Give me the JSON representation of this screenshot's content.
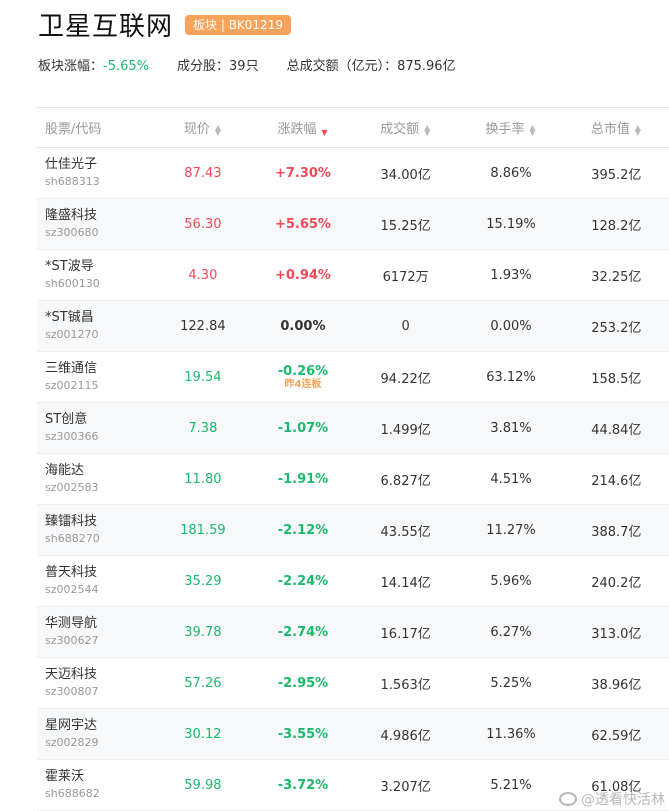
{
  "header": {
    "title": "卫星互联网",
    "tag": "板块 | BK01219"
  },
  "summary": {
    "change_label": "板块涨幅：",
    "change_value": "-5.65%",
    "count_label": "成分股：",
    "count_value": "39只",
    "turnover_label": "总成交额（亿元）：",
    "turnover_value": "875.96亿"
  },
  "table": {
    "headers": [
      "股票/代码",
      "现价",
      "涨跌幅",
      "成交额",
      "换手率",
      "总市值"
    ],
    "rows": [
      {
        "name": "仕佳光子",
        "code": "sh688313",
        "price": "87.43",
        "change": "+7.30%",
        "amount": "34.00亿",
        "turnover": "8.86%",
        "cap": "395.2亿",
        "dir": "red",
        "note": ""
      },
      {
        "name": "隆盛科技",
        "code": "sz300680",
        "price": "56.30",
        "change": "+5.65%",
        "amount": "15.25亿",
        "turnover": "15.19%",
        "cap": "128.2亿",
        "dir": "red",
        "note": ""
      },
      {
        "name": "*ST波导",
        "code": "sh600130",
        "price": "4.30",
        "change": "+0.94%",
        "amount": "6172万",
        "turnover": "1.93%",
        "cap": "32.25亿",
        "dir": "red",
        "note": ""
      },
      {
        "name": "*ST铖昌",
        "code": "sz001270",
        "price": "122.84",
        "change": "0.00%",
        "amount": "0",
        "turnover": "0.00%",
        "cap": "253.2亿",
        "dir": "black",
        "note": ""
      },
      {
        "name": "三维通信",
        "code": "sz002115",
        "price": "19.54",
        "change": "-0.26%",
        "amount": "94.22亿",
        "turnover": "63.12%",
        "cap": "158.5亿",
        "dir": "green",
        "note": "昨4连板"
      },
      {
        "name": "ST创意",
        "code": "sz300366",
        "price": "7.38",
        "change": "-1.07%",
        "amount": "1.499亿",
        "turnover": "3.81%",
        "cap": "44.84亿",
        "dir": "green",
        "note": ""
      },
      {
        "name": "海能达",
        "code": "sz002583",
        "price": "11.80",
        "change": "-1.91%",
        "amount": "6.827亿",
        "turnover": "4.51%",
        "cap": "214.6亿",
        "dir": "green",
        "note": ""
      },
      {
        "name": "臻镭科技",
        "code": "sh688270",
        "price": "181.59",
        "change": "-2.12%",
        "amount": "43.55亿",
        "turnover": "11.27%",
        "cap": "388.7亿",
        "dir": "green",
        "note": ""
      },
      {
        "name": "普天科技",
        "code": "sz002544",
        "price": "35.29",
        "change": "-2.24%",
        "amount": "14.14亿",
        "turnover": "5.96%",
        "cap": "240.2亿",
        "dir": "green",
        "note": ""
      },
      {
        "name": "华测导航",
        "code": "sz300627",
        "price": "39.78",
        "change": "-2.74%",
        "amount": "16.17亿",
        "turnover": "6.27%",
        "cap": "313.0亿",
        "dir": "green",
        "note": ""
      },
      {
        "name": "天迈科技",
        "code": "sz300807",
        "price": "57.26",
        "change": "-2.95%",
        "amount": "1.563亿",
        "turnover": "5.25%",
        "cap": "38.96亿",
        "dir": "green",
        "note": ""
      },
      {
        "name": "星网宇达",
        "code": "sz002829",
        "price": "30.12",
        "change": "-3.55%",
        "amount": "4.986亿",
        "turnover": "11.36%",
        "cap": "62.59亿",
        "dir": "green",
        "note": ""
      },
      {
        "name": "霍莱沃",
        "code": "sh688682",
        "price": "59.98",
        "change": "-3.72%",
        "amount": "3.207亿",
        "turnover": "5.21%",
        "cap": "61.08亿",
        "dir": "green",
        "note": ""
      }
    ]
  },
  "watermark": {
    "text": "@透看快活林"
  },
  "colors": {
    "up": "#f24957",
    "down": "#1bb96c",
    "tag": "#f7a35c"
  }
}
